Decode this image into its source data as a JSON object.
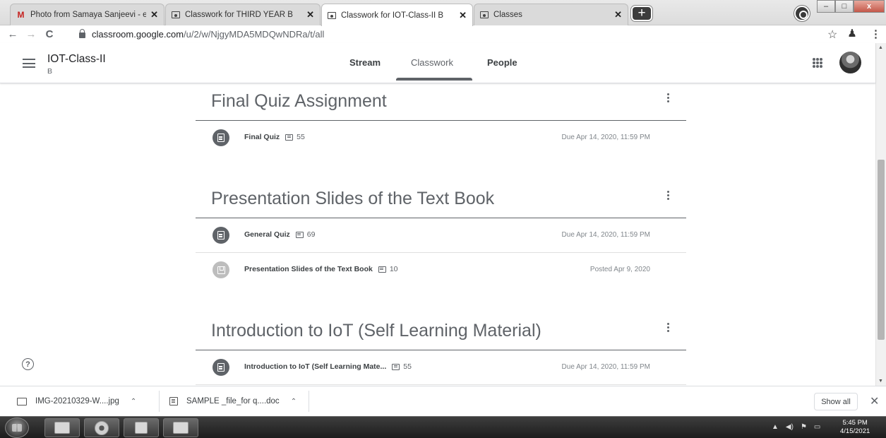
{
  "browser": {
    "tabs": [
      {
        "title": "Photo from Samaya Sanjeevi - en",
        "icon": "gmail-icon",
        "active": false
      },
      {
        "title": "Classwork for THIRD YEAR B",
        "icon": "classroom-icon",
        "active": false
      },
      {
        "title": "Classwork for IOT-Class-II B",
        "icon": "classroom-icon",
        "active": true
      },
      {
        "title": "Classes",
        "icon": "classroom-icon",
        "active": false
      }
    ],
    "new_tab_label": "+",
    "window_controls": {
      "minimize": "–",
      "maximize": "□",
      "close": "x"
    },
    "url_host": "classroom.google.com",
    "url_path": "/u/2/w/NjgyMDA5MDQwNDRa/t/all",
    "nav": {
      "back": "←",
      "forward": "→",
      "reload": "C"
    }
  },
  "header": {
    "class_title": "IOT-Class-II",
    "class_section": "B",
    "tabs": [
      {
        "label": "Stream",
        "selected": false
      },
      {
        "label": "Classwork",
        "selected": true
      },
      {
        "label": "People",
        "selected": false
      }
    ]
  },
  "topics": [
    {
      "title": "Final Quiz Assignment",
      "items": [
        {
          "type": "assignment",
          "title": "Final Quiz",
          "comments": "55",
          "status": "Due Apr 14, 2020, 11:59 PM"
        }
      ]
    },
    {
      "title": "Presentation Slides of the Text Book",
      "items": [
        {
          "type": "assignment",
          "title": "General Quiz",
          "comments": "69",
          "status": "Due Apr 14, 2020, 11:59 PM"
        },
        {
          "type": "material",
          "title": "Presentation Slides of the Text Book",
          "comments": "10",
          "status": "Posted Apr 9, 2020"
        }
      ]
    },
    {
      "title": "Introduction to IoT (Self Learning Material)",
      "items": [
        {
          "type": "assignment",
          "title": "Introduction to IoT (Self Learning Mate...",
          "comments": "55",
          "status": "Due Apr 14, 2020, 11:59 PM"
        }
      ]
    }
  ],
  "help_label": "?",
  "downloads": {
    "items": [
      {
        "name": "IMG-20210329-W....jpg",
        "icon": "image-file-icon"
      },
      {
        "name": "SAMPLE _file_for q....doc",
        "icon": "doc-file-icon"
      }
    ],
    "show_all_label": "Show all",
    "close_label": "✕"
  },
  "taskbar": {
    "time": "5:45 PM",
    "date": "4/15/2021"
  }
}
